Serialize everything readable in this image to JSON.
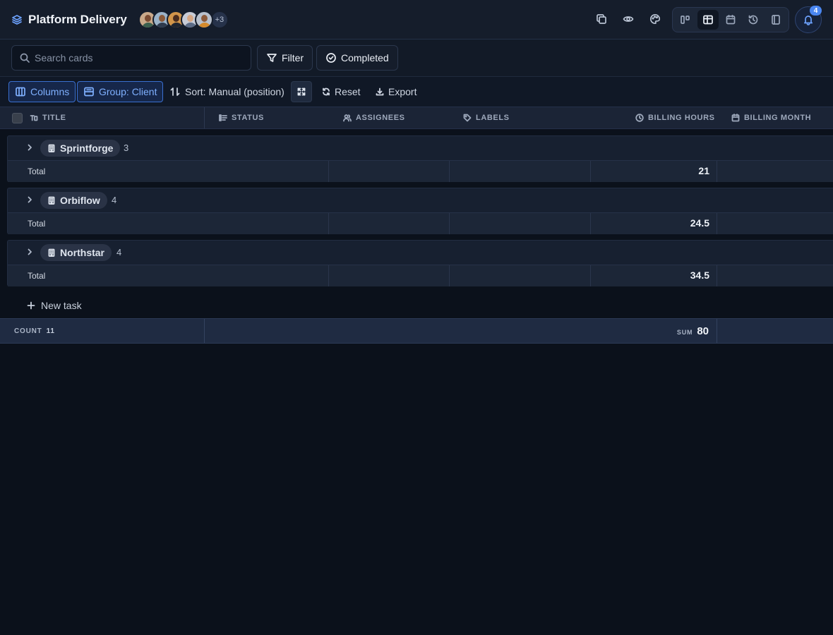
{
  "app": {
    "title": "Platform Delivery",
    "extra_members": "+3",
    "notifications_count": "4"
  },
  "colors": {
    "accent": "#4a86f0",
    "background": "#0b111b",
    "surface": "#151d2b"
  },
  "icons": {
    "logo": "layers-icon",
    "copy": "copy-icon",
    "watch": "eye-icon",
    "theme": "palette-icon",
    "bell": "bell-icon"
  },
  "search": {
    "placeholder": "Search cards",
    "value": ""
  },
  "filters": {
    "filter_label": "Filter",
    "completed_label": "Completed"
  },
  "toolbar": {
    "columns_label": "Columns",
    "group_label": "Group: Client",
    "sort_label": "Sort: Manual (position)",
    "reset_label": "Reset",
    "export_label": "Export"
  },
  "columns": {
    "title": "TITLE",
    "status": "STATUS",
    "assignees": "ASSIGNEES",
    "labels": "LABELS",
    "billing_hours": "BILLING HOURS",
    "billing_month": "BILLING MONTH"
  },
  "groups": [
    {
      "name": "Sprintforge",
      "count": "3",
      "total_label": "Total",
      "total_hours": "21"
    },
    {
      "name": "Orbiflow",
      "count": "4",
      "total_label": "Total",
      "total_hours": "24.5"
    },
    {
      "name": "Northstar",
      "count": "4",
      "total_label": "Total",
      "total_hours": "34.5"
    }
  ],
  "new_task_label": "New task",
  "footer": {
    "count_label": "COUNT",
    "count_value": "11",
    "sum_label": "SUM",
    "sum_value": "80"
  }
}
